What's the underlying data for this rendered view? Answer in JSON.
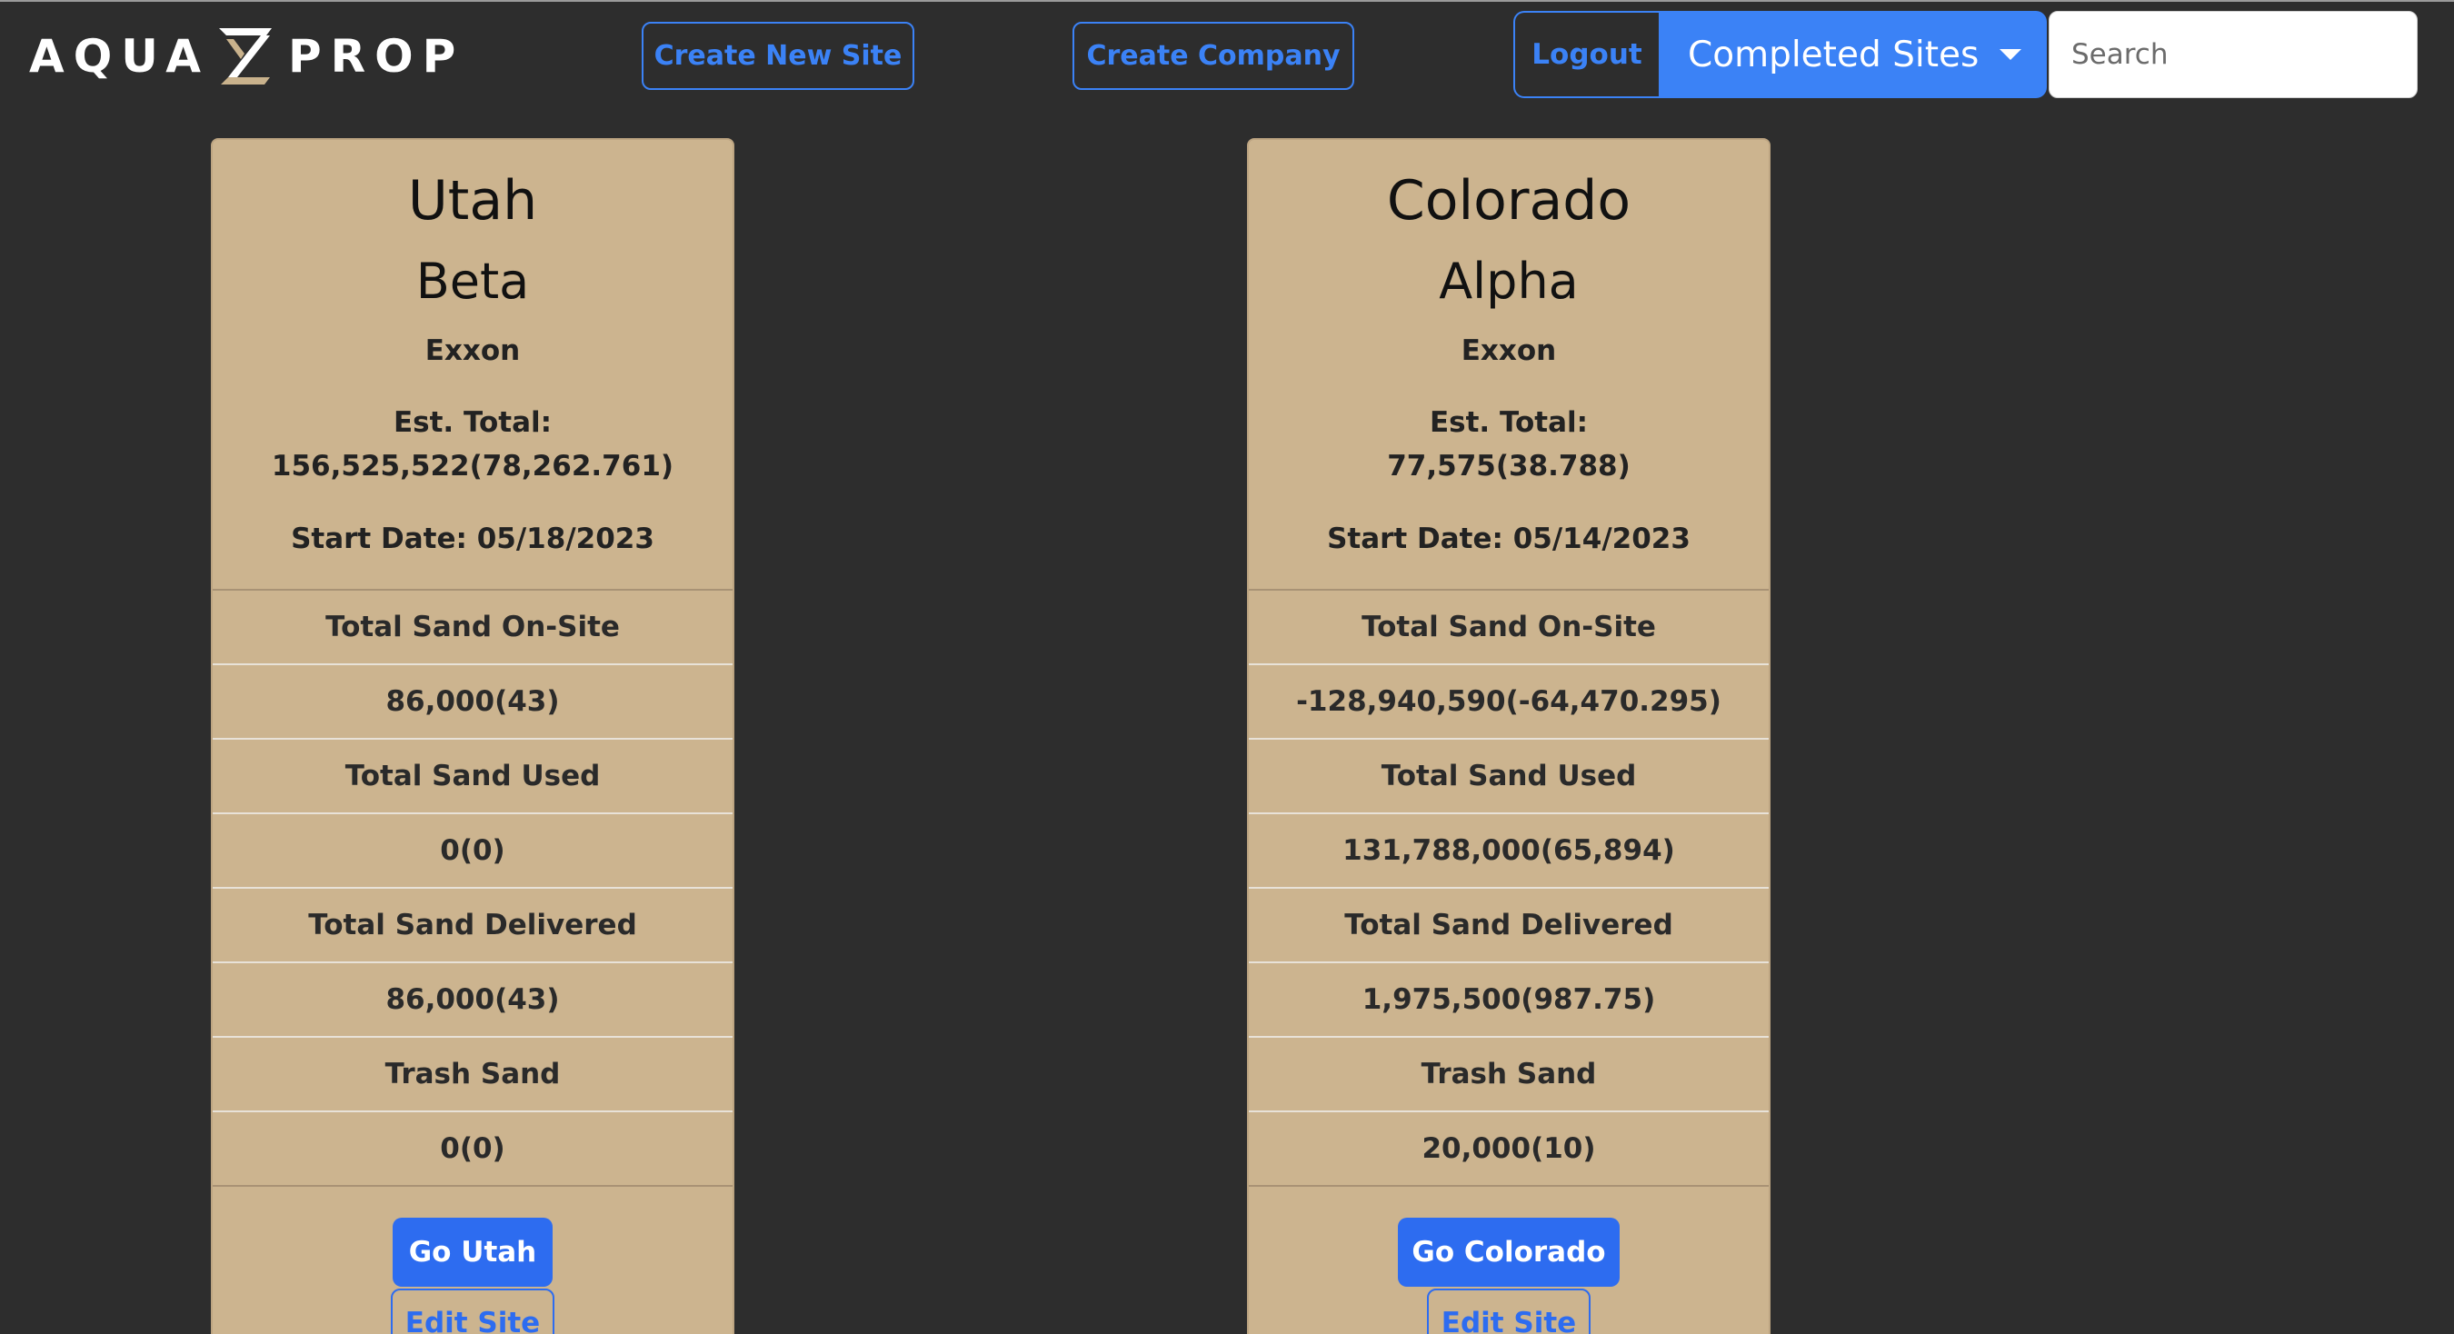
{
  "header": {
    "logo_left": "AQUA",
    "logo_right": "PROP",
    "create_site_label": "Create New Site",
    "create_company_label": "Create Company",
    "logout_label": "Logout",
    "filter_selected": "Completed Sites",
    "search_placeholder": "Search"
  },
  "colors": {
    "background": "#2d2d2d",
    "accent": "#3b82f6",
    "card": "#ccb48f"
  },
  "sites": [
    {
      "title": "Utah",
      "subtitle": "Beta",
      "company": "Exxon",
      "est_label": "Est. Total:",
      "est_value": "156,525,522(78,262.761)",
      "start_date": "Start Date: 05/18/2023",
      "rows": [
        "Total Sand On-Site",
        "86,000(43)",
        "Total Sand Used",
        "0(0)",
        "Total Sand Delivered",
        "86,000(43)",
        "Trash Sand",
        "0(0)"
      ],
      "go_label": "Go Utah",
      "edit_label": "Edit Site"
    },
    {
      "title": "Colorado",
      "subtitle": "Alpha",
      "company": "Exxon",
      "est_label": "Est. Total:",
      "est_value": "77,575(38.788)",
      "start_date": "Start Date: 05/14/2023",
      "rows": [
        "Total Sand On-Site",
        "-128,940,590(-64,470.295)",
        "Total Sand Used",
        "131,788,000(65,894)",
        "Total Sand Delivered",
        "1,975,500(987.75)",
        "Trash Sand",
        "20,000(10)"
      ],
      "go_label": "Go Colorado",
      "edit_label": "Edit Site"
    }
  ]
}
